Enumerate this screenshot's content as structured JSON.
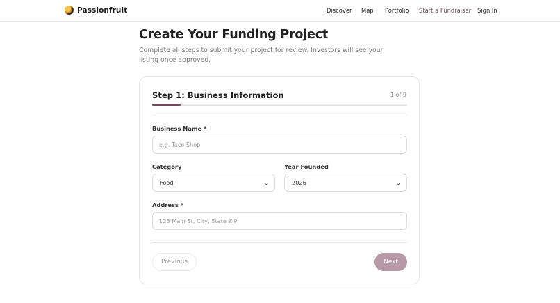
{
  "nav": {
    "brand": "Passionfruit",
    "links": [
      "Discover",
      "Map",
      "Portfolio",
      "Start a Fundraiser",
      "Sign In"
    ]
  },
  "page": {
    "title": "Create Your Funding Project",
    "subtitle": "Complete all steps to submit your project for review. Investors will see your listing once approved."
  },
  "form": {
    "step_title": "Step 1: Business Information",
    "step_count": "1 of 9",
    "progress_fraction": 0.111,
    "accent_color": "#6e4a5c",
    "business_name": {
      "label": "Business Name *",
      "placeholder": "e.g. Taco Shop",
      "value": ""
    },
    "category": {
      "label": "Category",
      "value": "Food"
    },
    "year_founded": {
      "label": "Year Founded",
      "value": "2026"
    },
    "address": {
      "label": "Address *",
      "placeholder": "123 Main St, City, State ZIP",
      "value": ""
    },
    "prev_label": "Previous",
    "next_label": "Next"
  }
}
